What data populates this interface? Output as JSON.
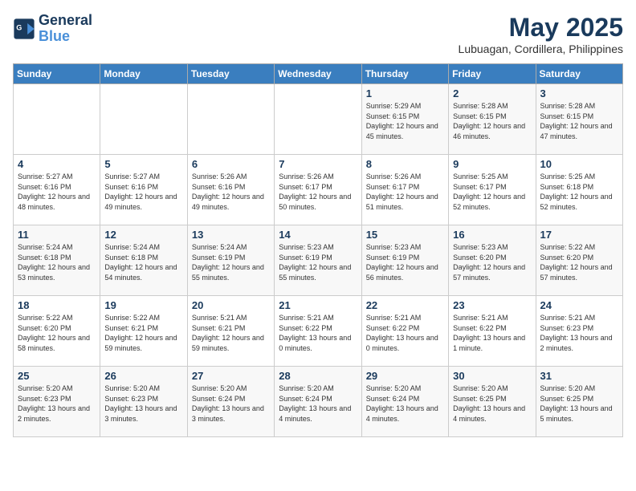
{
  "logo": {
    "line1": "General",
    "line2": "Blue"
  },
  "title": "May 2025",
  "location": "Lubuagan, Cordillera, Philippines",
  "days_of_week": [
    "Sunday",
    "Monday",
    "Tuesday",
    "Wednesday",
    "Thursday",
    "Friday",
    "Saturday"
  ],
  "weeks": [
    [
      {
        "day": "",
        "sunrise": "",
        "sunset": "",
        "daylight": ""
      },
      {
        "day": "",
        "sunrise": "",
        "sunset": "",
        "daylight": ""
      },
      {
        "day": "",
        "sunrise": "",
        "sunset": "",
        "daylight": ""
      },
      {
        "day": "",
        "sunrise": "",
        "sunset": "",
        "daylight": ""
      },
      {
        "day": "1",
        "sunrise": "5:29 AM",
        "sunset": "6:15 PM",
        "daylight": "12 hours and 45 minutes."
      },
      {
        "day": "2",
        "sunrise": "5:28 AM",
        "sunset": "6:15 PM",
        "daylight": "12 hours and 46 minutes."
      },
      {
        "day": "3",
        "sunrise": "5:28 AM",
        "sunset": "6:15 PM",
        "daylight": "12 hours and 47 minutes."
      }
    ],
    [
      {
        "day": "4",
        "sunrise": "5:27 AM",
        "sunset": "6:16 PM",
        "daylight": "12 hours and 48 minutes."
      },
      {
        "day": "5",
        "sunrise": "5:27 AM",
        "sunset": "6:16 PM",
        "daylight": "12 hours and 49 minutes."
      },
      {
        "day": "6",
        "sunrise": "5:26 AM",
        "sunset": "6:16 PM",
        "daylight": "12 hours and 49 minutes."
      },
      {
        "day": "7",
        "sunrise": "5:26 AM",
        "sunset": "6:17 PM",
        "daylight": "12 hours and 50 minutes."
      },
      {
        "day": "8",
        "sunrise": "5:26 AM",
        "sunset": "6:17 PM",
        "daylight": "12 hours and 51 minutes."
      },
      {
        "day": "9",
        "sunrise": "5:25 AM",
        "sunset": "6:17 PM",
        "daylight": "12 hours and 52 minutes."
      },
      {
        "day": "10",
        "sunrise": "5:25 AM",
        "sunset": "6:18 PM",
        "daylight": "12 hours and 52 minutes."
      }
    ],
    [
      {
        "day": "11",
        "sunrise": "5:24 AM",
        "sunset": "6:18 PM",
        "daylight": "12 hours and 53 minutes."
      },
      {
        "day": "12",
        "sunrise": "5:24 AM",
        "sunset": "6:18 PM",
        "daylight": "12 hours and 54 minutes."
      },
      {
        "day": "13",
        "sunrise": "5:24 AM",
        "sunset": "6:19 PM",
        "daylight": "12 hours and 55 minutes."
      },
      {
        "day": "14",
        "sunrise": "5:23 AM",
        "sunset": "6:19 PM",
        "daylight": "12 hours and 55 minutes."
      },
      {
        "day": "15",
        "sunrise": "5:23 AM",
        "sunset": "6:19 PM",
        "daylight": "12 hours and 56 minutes."
      },
      {
        "day": "16",
        "sunrise": "5:23 AM",
        "sunset": "6:20 PM",
        "daylight": "12 hours and 57 minutes."
      },
      {
        "day": "17",
        "sunrise": "5:22 AM",
        "sunset": "6:20 PM",
        "daylight": "12 hours and 57 minutes."
      }
    ],
    [
      {
        "day": "18",
        "sunrise": "5:22 AM",
        "sunset": "6:20 PM",
        "daylight": "12 hours and 58 minutes."
      },
      {
        "day": "19",
        "sunrise": "5:22 AM",
        "sunset": "6:21 PM",
        "daylight": "12 hours and 59 minutes."
      },
      {
        "day": "20",
        "sunrise": "5:21 AM",
        "sunset": "6:21 PM",
        "daylight": "12 hours and 59 minutes."
      },
      {
        "day": "21",
        "sunrise": "5:21 AM",
        "sunset": "6:22 PM",
        "daylight": "13 hours and 0 minutes."
      },
      {
        "day": "22",
        "sunrise": "5:21 AM",
        "sunset": "6:22 PM",
        "daylight": "13 hours and 0 minutes."
      },
      {
        "day": "23",
        "sunrise": "5:21 AM",
        "sunset": "6:22 PM",
        "daylight": "13 hours and 1 minute."
      },
      {
        "day": "24",
        "sunrise": "5:21 AM",
        "sunset": "6:23 PM",
        "daylight": "13 hours and 2 minutes."
      }
    ],
    [
      {
        "day": "25",
        "sunrise": "5:20 AM",
        "sunset": "6:23 PM",
        "daylight": "13 hours and 2 minutes."
      },
      {
        "day": "26",
        "sunrise": "5:20 AM",
        "sunset": "6:23 PM",
        "daylight": "13 hours and 3 minutes."
      },
      {
        "day": "27",
        "sunrise": "5:20 AM",
        "sunset": "6:24 PM",
        "daylight": "13 hours and 3 minutes."
      },
      {
        "day": "28",
        "sunrise": "5:20 AM",
        "sunset": "6:24 PM",
        "daylight": "13 hours and 4 minutes."
      },
      {
        "day": "29",
        "sunrise": "5:20 AM",
        "sunset": "6:24 PM",
        "daylight": "13 hours and 4 minutes."
      },
      {
        "day": "30",
        "sunrise": "5:20 AM",
        "sunset": "6:25 PM",
        "daylight": "13 hours and 4 minutes."
      },
      {
        "day": "31",
        "sunrise": "5:20 AM",
        "sunset": "6:25 PM",
        "daylight": "13 hours and 5 minutes."
      }
    ]
  ]
}
